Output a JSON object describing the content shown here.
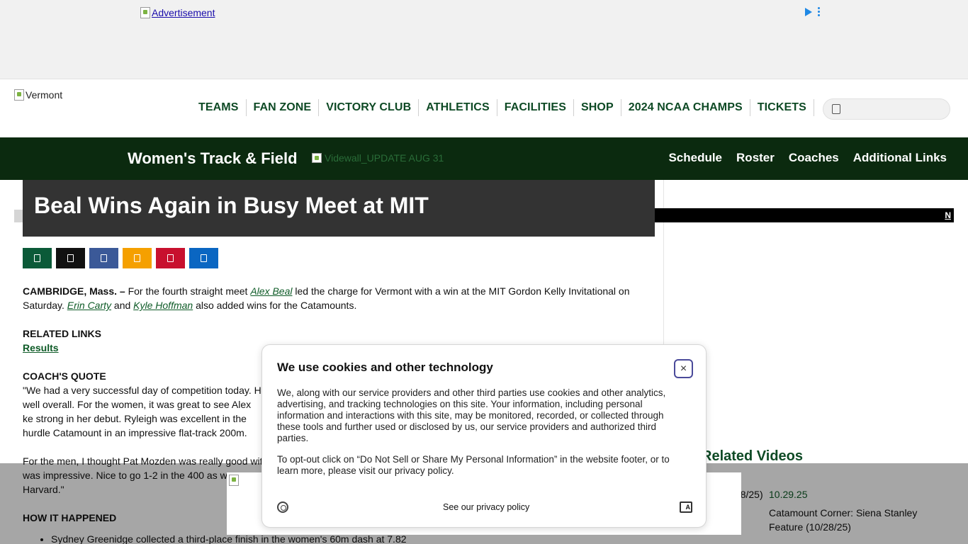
{
  "ad_top": {
    "alt_text": "Advertisement"
  },
  "header": {
    "logo_alt": "Vermont",
    "nav": [
      "TEAMS",
      "FAN ZONE",
      "VICTORY CLUB",
      "ATHLETICS",
      "FACILITIES",
      "SHOP",
      "2024 NCAA CHAMPS",
      "TICKETS"
    ],
    "search_placeholder": ""
  },
  "sportbar": {
    "title": "Women's Track & Field",
    "sponsor_alt": "Videwall_UPDATE AUG 31",
    "nav": [
      "Schedule",
      "Roster",
      "Coaches",
      "Additional Links"
    ]
  },
  "article": {
    "headline": "Beal Wins Again in Busy Meet at MIT",
    "share_colors": [
      "#0b5a38",
      "#111111",
      "#3b5998",
      "#f5a000",
      "#c8102e",
      "#0a66c2"
    ],
    "share_icons": [
      "email-icon",
      "x-icon",
      "facebook-icon",
      "rss-icon",
      "pinterest-icon",
      "linkedin-icon"
    ],
    "dateline": "CAMBRIDGE, Mass. –",
    "intro_1": " For the fourth straight meet ",
    "athlete_1": "Alex Beal",
    "intro_2": " led the charge for Vermont with a win at the MIT Gordon Kelly Invitational on Saturday. ",
    "athlete_2": "Erin Carty",
    "intro_3": " and ",
    "athlete_3": "Kyle Hoffman",
    "intro_4": " also added wins for the Catamounts.",
    "related_links_heading": "RELATED LINKS",
    "results_link": "Results",
    "coach_quote_heading": "COACH'S QUOTE",
    "quote_p1": "\"We had a very successful day of competition today. H well overall. For the women, it was great to see Alex ke strong in her debut. Ryleigh was excellent in the hurdle Catamount in an impressive flat-track 200m.",
    "quote_p2": "For the men, I thought Pat Mozden was really good wit was impressive. Nice to go 1-2 in the 400 as w Harvard.\"",
    "how_heading": "HOW IT HAPPENED",
    "bullet_1": "Sydney Greenidge collected a third-place finish in the women's 60m dash at 7.82"
  },
  "rail": {
    "related_videos": "Related Videos",
    "thumb_text": "t a re (10/28/25)",
    "video_date": "10.29.25",
    "video_title": "Catamount Corner: Siena Stanley Feature (10/28/25)"
  },
  "cookie": {
    "title": "We use cookies and other technology",
    "body1": "We, along with our service providers and other third parties use cookies and other analytics, advertising, and tracking technologies on this site. Your information, including personal information and interactions with this site, may be monitored, recorded, or collected through these tools and further used or disclosed by us, our service providers and authorized third parties.",
    "body2": "To opt-out click on “Do Not Sell or Share My Personal Information” in the website footer, or to learn more, please visit our privacy policy.",
    "privacy_link": "See our privacy policy",
    "close_symbol": "×",
    "translate_symbol": "A"
  }
}
